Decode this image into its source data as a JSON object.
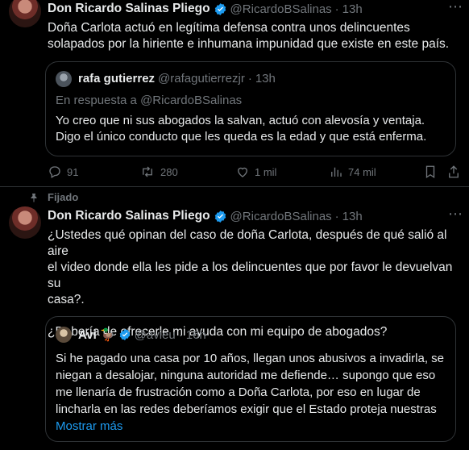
{
  "tweet1": {
    "author_name": "Don Ricardo Salinas Pliego",
    "handle": "@RicardoBSalinas",
    "time": "13h",
    "text_line1": "Doña Carlota actuó en legítima defensa contra unos delincuentes",
    "text_line2": "solapados por la hiriente e inhumana impunidad que existe en este país.",
    "quote": {
      "author_name": "rafa gutierrez",
      "handle": "@rafagutierrezjr",
      "time": "13h",
      "reply_to": "En respuesta a @RicardoBSalinas",
      "text_line1": "Yo creo que ni sus abogados la salvan, actuó con alevosía y ventaja.",
      "text_line2": "Digo el único conducto que les queda es la edad y que está enferma."
    },
    "actions": {
      "replies": "91",
      "reposts": "280",
      "likes": "1 mil",
      "views": "74 mil"
    }
  },
  "tweet2": {
    "pinned_label": "Fijado",
    "author_name": "Don Ricardo Salinas Pliego",
    "handle": "@RicardoBSalinas",
    "time": "13h",
    "text_line1": "¿Ustedes qué opinan del caso de doña Carlota, después de qué salió al aire",
    "text_line2": "el video donde ella les pide a los delincuentes que por favor le devuelvan su",
    "text_line3": "casa?.",
    "text_line4": "¿Debería de ofrecerle mi ayuda con mi equipo de abogados?",
    "quote": {
      "author_name": "Avi 🦆",
      "handle": "@avieu",
      "time": "16h",
      "text_line1": "Si he pagado una casa por 10 años, llegan unos abusivos a invadirla, se",
      "text_line2": "niegan a desalojar, ninguna autoridad me defiende… supongo que eso",
      "text_line3": "me llenaría de frustración como a Doña Carlota, por eso en lugar de",
      "text_line4": "lincharla en las redes deberíamos exigir que el Estado proteja nuestras",
      "show_more": "Mostrar más"
    }
  },
  "separator": "·",
  "colors": {
    "accent": "#1d9bf0",
    "muted": "#71767b",
    "text": "#e7e9ea",
    "border": "#2f3336"
  }
}
